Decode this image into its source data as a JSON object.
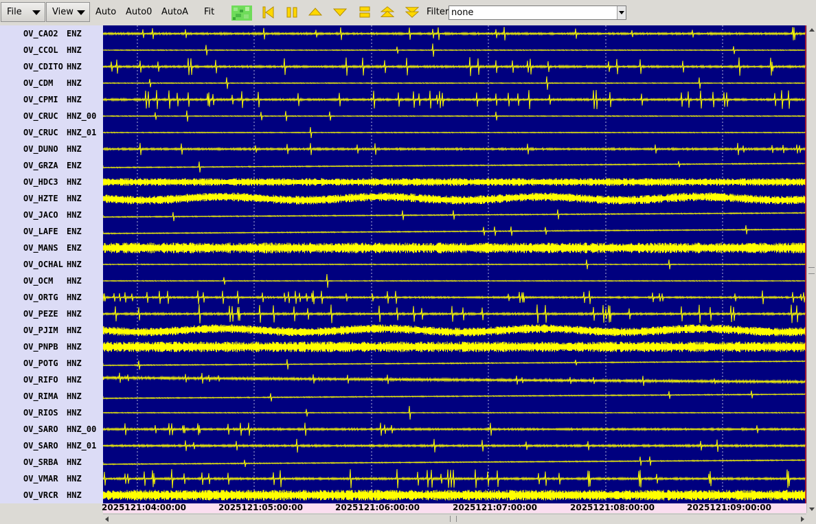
{
  "toolbar": {
    "file_label": "File",
    "view_label": "View",
    "auto_label": "Auto",
    "auto0_label": "Auto0",
    "autoa_label": "AutoA",
    "fit_label": "Fit",
    "filter_label": "Filter",
    "filter_value": "none",
    "icons": [
      "color-map-icon",
      "go-to-start-icon",
      "pause-icon",
      "scroll-up-icon",
      "scroll-down-icon",
      "fit-height-icon",
      "expand-up-icon",
      "expand-down-icon"
    ],
    "colors": {
      "icon_fill": "#ffd800",
      "icon_stroke": "#b28c00"
    }
  },
  "plot": {
    "background": "#00007f",
    "trace_color": "#ffff00",
    "grid_color": "#ffffff",
    "time_labels": [
      "2025121:04:00:00",
      "2025121:05:00:00",
      "2025121:06:00:00",
      "2025121:07:00:00",
      "2025121:08:00:00",
      "2025121:09:00:00"
    ]
  },
  "channels": [
    {
      "station": "OV_CAO2",
      "channel": "ENZ",
      "style": "quiet"
    },
    {
      "station": "OV_CCOL",
      "channel": "HNZ",
      "style": "flat"
    },
    {
      "station": "OV_CDITO",
      "channel": "HNZ",
      "style": "spiky"
    },
    {
      "station": "OV_CDM",
      "channel": "HNZ",
      "style": "flat"
    },
    {
      "station": "OV_CPMI",
      "channel": "HNZ",
      "style": "spiky"
    },
    {
      "station": "OV_CRUC",
      "channel": "HNZ_00",
      "style": "flat"
    },
    {
      "station": "OV_CRUC",
      "channel": "HNZ_01",
      "style": "flat"
    },
    {
      "station": "OV_DUNO",
      "channel": "HNZ",
      "style": "quiet"
    },
    {
      "station": "OV_GRZA",
      "channel": "ENZ",
      "style": "drift"
    },
    {
      "station": "OV_HDC3",
      "channel": "HNZ",
      "style": "band-medium"
    },
    {
      "station": "OV_HZTE",
      "channel": "HNZ",
      "style": "band-wavy"
    },
    {
      "station": "OV_JACO",
      "channel": "HNZ",
      "style": "drift"
    },
    {
      "station": "OV_LAFE",
      "channel": "ENZ",
      "style": "drift"
    },
    {
      "station": "OV_MANS",
      "channel": "ENZ",
      "style": "band-thick"
    },
    {
      "station": "OV_OCHAL",
      "channel": "HNZ",
      "style": "flat"
    },
    {
      "station": "OV_OCM",
      "channel": "HNZ",
      "style": "flat"
    },
    {
      "station": "OV_ORTG",
      "channel": "HNZ",
      "style": "bursty"
    },
    {
      "station": "OV_PEZE",
      "channel": "HNZ",
      "style": "spiky"
    },
    {
      "station": "OV_PJIM",
      "channel": "HNZ",
      "style": "band-wavy"
    },
    {
      "station": "OV_PNPB",
      "channel": "HNZ",
      "style": "band-thick"
    },
    {
      "station": "OV_POTG",
      "channel": "HNZ",
      "style": "drift"
    },
    {
      "station": "OV_RIFO",
      "channel": "HNZ",
      "style": "drift-noisy"
    },
    {
      "station": "OV_RIMA",
      "channel": "HNZ",
      "style": "drift"
    },
    {
      "station": "OV_RIOS",
      "channel": "HNZ",
      "style": "flat"
    },
    {
      "station": "OV_SARO",
      "channel": "HNZ_00",
      "style": "quiet"
    },
    {
      "station": "OV_SARO",
      "channel": "HNZ_01",
      "style": "quiet"
    },
    {
      "station": "OV_SRBA",
      "channel": "HNZ",
      "style": "drift"
    },
    {
      "station": "OV_VMAR",
      "channel": "HNZ",
      "style": "spiky"
    },
    {
      "station": "OV_VRCR",
      "channel": "HNZ",
      "style": "band-thick"
    }
  ],
  "scrollbars": {
    "vertical": "visible",
    "horizontal": "visible"
  }
}
